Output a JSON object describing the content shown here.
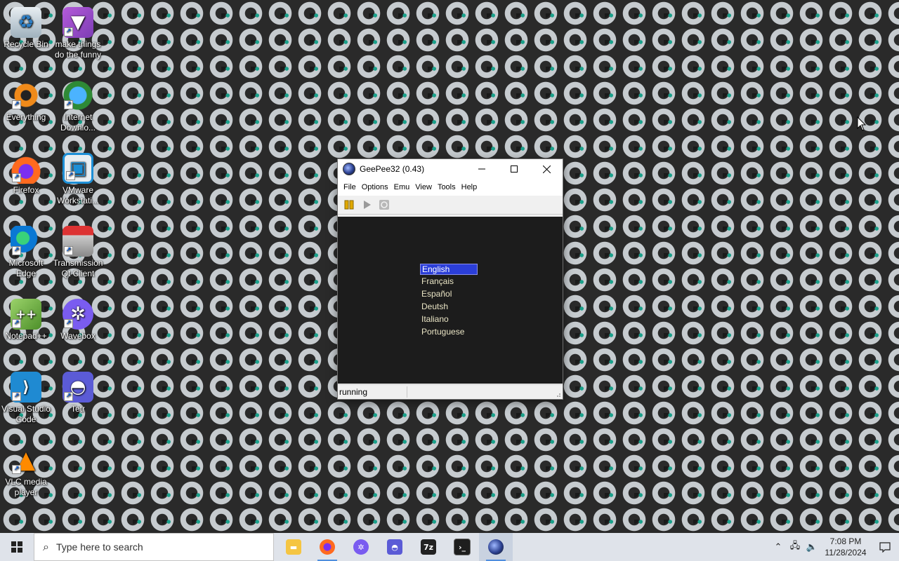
{
  "desktop": {
    "icons": [
      {
        "label": "Recycle Bin",
        "icon": "recycle-bin-icon"
      },
      {
        "label": "make things do the funny",
        "icon": "shortcut-icon"
      },
      {
        "label": "Everything",
        "icon": "everything-search-icon"
      },
      {
        "label": "Internet Downlo...",
        "icon": "internet-download-manager-icon"
      },
      {
        "label": "Firefox",
        "icon": "firefox-icon"
      },
      {
        "label": "VMware Workstati...",
        "icon": "vmware-icon"
      },
      {
        "label": "Microsoft Edge",
        "icon": "edge-icon"
      },
      {
        "label": "Transmission Qt Client",
        "icon": "transmission-icon"
      },
      {
        "label": "Notepad++",
        "icon": "notepad-plus-plus-icon"
      },
      {
        "label": "Wavebox",
        "icon": "wavebox-icon"
      },
      {
        "label": "Visual Studio Code",
        "icon": "vscode-icon"
      },
      {
        "label": "Tetr",
        "icon": "tetr-icon"
      },
      {
        "label": "VLC media player",
        "icon": "vlc-icon"
      }
    ]
  },
  "window": {
    "title": "GeePee32 (0.43)",
    "menu": [
      "File",
      "Options",
      "Emu",
      "View",
      "Tools",
      "Help"
    ],
    "toolbar": [
      "pause-icon",
      "play-icon",
      "reset-icon"
    ],
    "languages": [
      "English",
      "Français",
      "Español",
      "Deutsh",
      "Italiano",
      "Portuguese"
    ],
    "selected_language": "English",
    "status": "running"
  },
  "taskbar": {
    "search_placeholder": "Type here to search",
    "apps": [
      "file-explorer-icon",
      "firefox-icon",
      "wavebox-icon",
      "tetr-icon",
      "7zip-icon",
      "terminal-icon",
      "geepee32-icon"
    ],
    "time": "7:08 PM",
    "date": "11/28/2024"
  },
  "colors": {
    "selection": "#2b3ed8",
    "emu_text": "#e9e4c4",
    "emu_bg": "#1c1c1c",
    "taskbar": "#dfe3ea"
  }
}
